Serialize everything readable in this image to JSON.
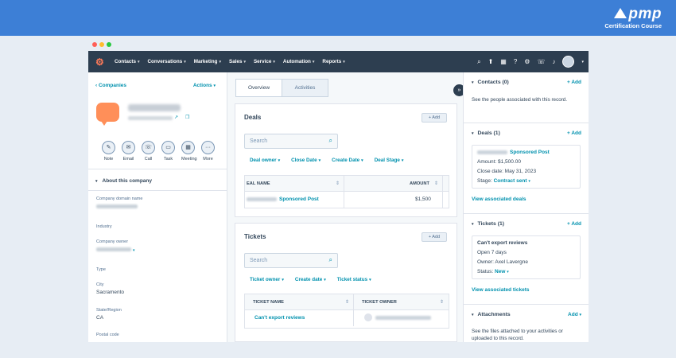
{
  "brand": {
    "logo": "pmp",
    "subtitle": "Certification Course"
  },
  "window_dots": [
    "#ff5f57",
    "#febc2e",
    "#28c840"
  ],
  "nav": {
    "items": [
      "Contacts",
      "Conversations",
      "Marketing",
      "Sales",
      "Service",
      "Automation",
      "Reports"
    ],
    "icons": [
      "search-icon",
      "upgrade-icon",
      "marketplace-icon",
      "help-icon",
      "settings-icon",
      "calling-icon",
      "notifications-icon",
      "avatar"
    ]
  },
  "left": {
    "breadcrumb": "Companies",
    "actions": "Actions",
    "quick_actions": [
      "Note",
      "Email",
      "Call",
      "Task",
      "Meeting",
      "More"
    ],
    "about_title": "About this company",
    "properties": [
      {
        "label": "Company domain name",
        "value": ""
      },
      {
        "label": "Industry",
        "value": ""
      },
      {
        "label": "Company owner",
        "value": ""
      },
      {
        "label": "Type",
        "value": ""
      },
      {
        "label": "City",
        "value": "Sacramento"
      },
      {
        "label": "State/Region",
        "value": "CA"
      },
      {
        "label": "Postal code",
        "value": ""
      }
    ]
  },
  "center": {
    "tabs": [
      "Overview",
      "Activities"
    ],
    "deals": {
      "title": "Deals",
      "add": "+ Add",
      "search_placeholder": "Search",
      "filters": [
        "Deal owner",
        "Close Date",
        "Create Date",
        "Deal Stage"
      ],
      "columns": [
        "EAL NAME",
        "AMOUNT"
      ],
      "rows": [
        {
          "name": "Sponsored Post",
          "amount": "$1,500"
        }
      ]
    },
    "tickets": {
      "title": "Tickets",
      "add": "+ Add",
      "search_placeholder": "Search",
      "filters": [
        "Ticket owner",
        "Create date",
        "Ticket status"
      ],
      "columns": [
        "TICKET NAME",
        "TICKET OWNER"
      ],
      "rows": [
        {
          "name": "Can't export reviews"
        }
      ]
    }
  },
  "right": {
    "contacts": {
      "title": "Contacts (0)",
      "add": "+ Add",
      "text": "See the people associated with this record."
    },
    "deals": {
      "title": "Deals (1)",
      "add": "+ Add",
      "name": "Sponsored Post",
      "amount": "Amount: $1,500.00",
      "close_date": "Close date: May 31, 2023",
      "stage_label": "Stage:",
      "stage_value": "Contract sent",
      "view": "View associated deals"
    },
    "tickets": {
      "title": "Tickets (1)",
      "add": "+ Add",
      "name": "Can't export reviews",
      "open": "Open 7 days",
      "owner": "Owner:  Axel Lavergne",
      "status_label": "Status:",
      "status_value": "New",
      "view": "View associated tickets"
    },
    "attachments": {
      "title": "Attachments",
      "add": "Add",
      "text": "See the files attached to your activities or uploaded to this record."
    }
  }
}
